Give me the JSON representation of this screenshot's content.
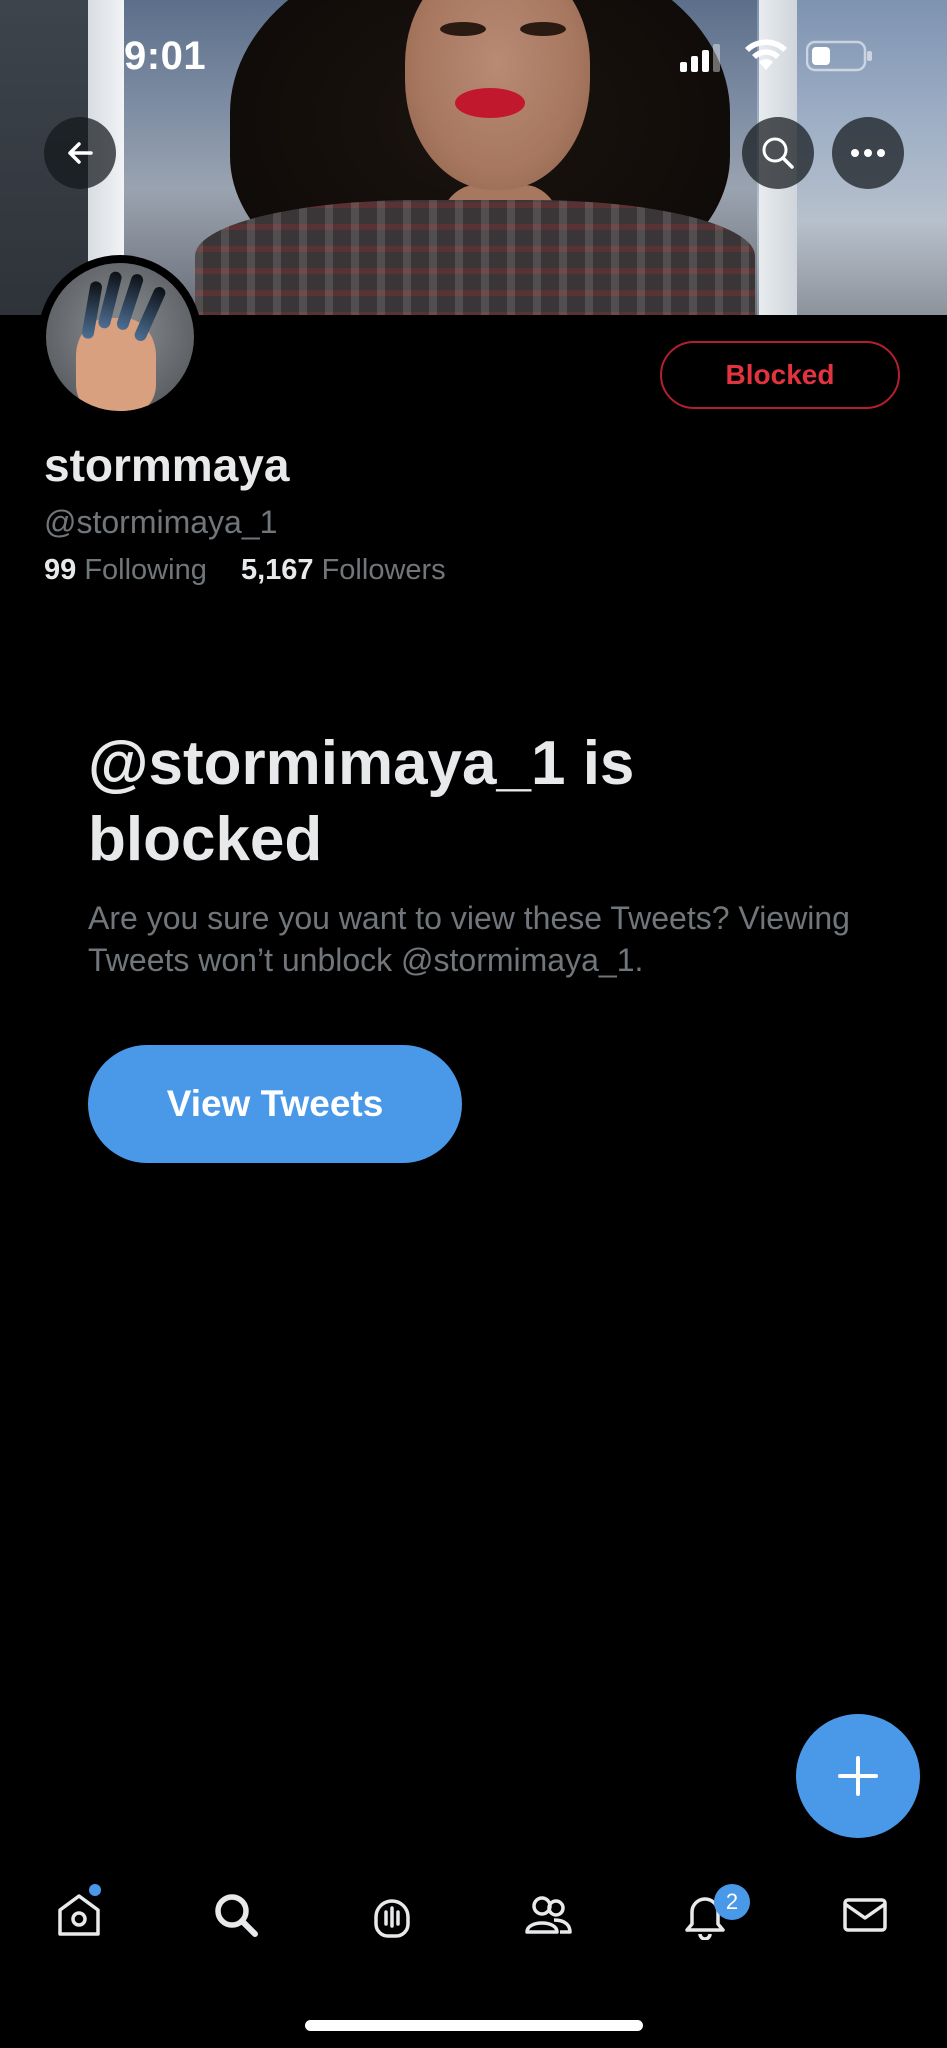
{
  "status_bar": {
    "time": "9:01",
    "signal_icon": "cellular-signal-icon",
    "wifi_icon": "wifi-icon",
    "battery_icon": "battery-icon"
  },
  "header": {
    "back_icon": "arrow-left-icon",
    "search_icon": "search-icon",
    "more_icon": "more-horizontal-icon"
  },
  "profile": {
    "display_name": "stormmaya",
    "handle": "@stormimaya_1",
    "following_count": "99",
    "following_label": "Following",
    "followers_count": "5,167",
    "followers_label": "Followers",
    "blocked_label": "Blocked"
  },
  "blocked_notice": {
    "title": "@stormimaya_1 is blocked",
    "description": "Are you sure you want to view these Tweets? Viewing Tweets won’t unblock @stormimaya_1.",
    "view_button_label": "View Tweets"
  },
  "compose": {
    "icon": "plus-icon"
  },
  "tab_bar": {
    "items": [
      {
        "name": "home",
        "icon": "home-icon"
      },
      {
        "name": "search",
        "icon": "search-icon"
      },
      {
        "name": "spaces",
        "icon": "spaces-microphone-icon"
      },
      {
        "name": "communities",
        "icon": "communities-icon"
      },
      {
        "name": "notifications",
        "icon": "bell-icon"
      },
      {
        "name": "messages",
        "icon": "envelope-icon"
      }
    ],
    "notifications_badge": "2"
  },
  "colors": {
    "background": "#000000",
    "accent": "#4a99e9",
    "blocked_red": "#e3333f",
    "secondary_text": "#71767b",
    "primary_text": "#e7e9ea"
  }
}
